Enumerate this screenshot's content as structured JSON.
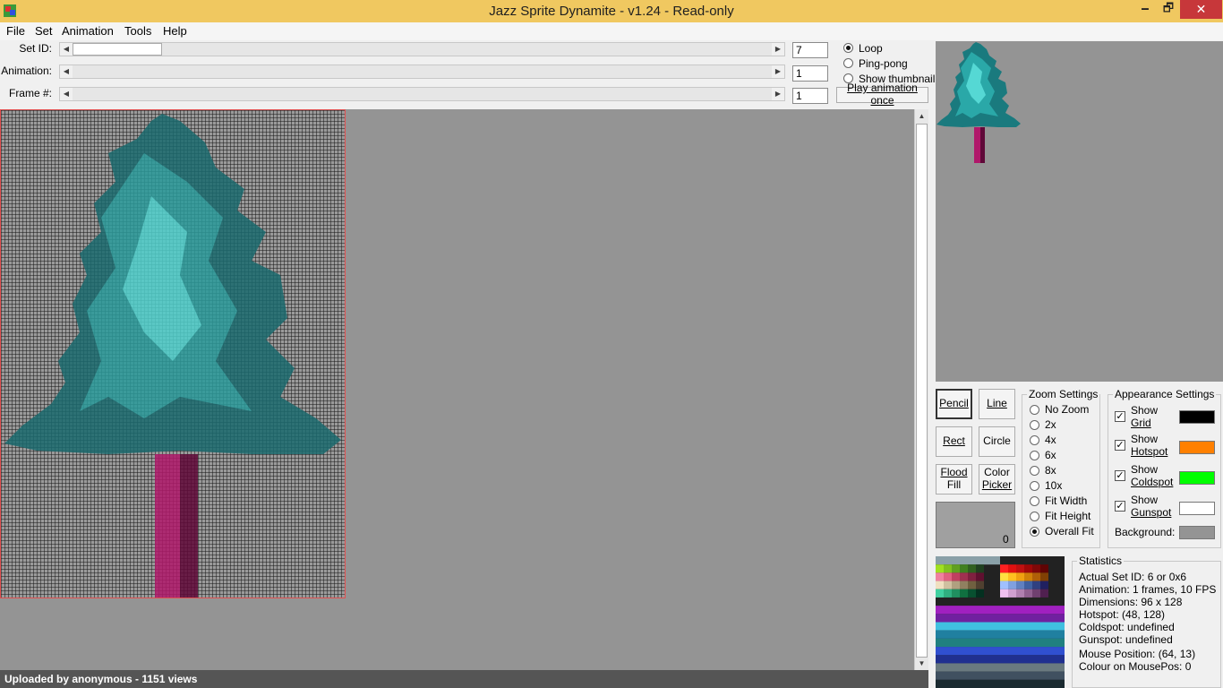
{
  "window": {
    "title": "Jazz Sprite Dynamite - v1.24 - Read-only",
    "min": "🗕",
    "max": "🗗",
    "close": "✕"
  },
  "menu": [
    "File",
    "Set",
    "Animation",
    "Tools",
    "Help"
  ],
  "controls": {
    "set_id": {
      "label": "Set ID:",
      "value": "7"
    },
    "animation": {
      "label": "Animation:",
      "value": "1"
    },
    "frame": {
      "label": "Frame #:",
      "value": "1"
    }
  },
  "playback": {
    "options": [
      "Loop",
      "Ping-pong",
      "Show thumbnail"
    ],
    "selected": "Loop",
    "play_button": "Play animation once"
  },
  "tools": {
    "pencil": "Pencil",
    "line": "Line",
    "rect": "Rect",
    "circle": "Circle",
    "flood_fill": [
      "Flood",
      "Fill"
    ],
    "color_picker": [
      "Color",
      "Picker"
    ],
    "selected": "Pencil",
    "color_index": "0"
  },
  "zoom": {
    "title": "Zoom Settings",
    "options": [
      "No Zoom",
      "2x",
      "4x",
      "6x",
      "8x",
      "10x",
      "Fit Width",
      "Fit Height",
      "Overall Fit"
    ],
    "selected": "Overall Fit"
  },
  "appearance": {
    "title": "Appearance Settings",
    "items": [
      {
        "line1": "Show",
        "line2": "Grid",
        "checked": true,
        "color": "#000000"
      },
      {
        "line1": "Show",
        "line2": "Hotspot",
        "checked": true,
        "color": "#ff8000"
      },
      {
        "line1": "Show",
        "line2": "Coldspot",
        "checked": true,
        "color": "#00ff00"
      },
      {
        "line1": "Show",
        "line2": "Gunspot",
        "checked": true,
        "color": "#ffffff"
      }
    ],
    "background_label": "Background:",
    "background_color": "#949494"
  },
  "statistics": {
    "title": "Statistics",
    "lines": [
      "Actual Set ID: 6 or 0x6",
      "Animation: 1 frames, 10 FPS",
      "Dimensions: 96 x 128",
      "Hotspot: (48, 128)",
      "Coldspot: undefined",
      "Gunspot: undefined",
      "Mouse Position: (64, 13)",
      "Colour on MousePos: 0"
    ]
  },
  "footer": {
    "note": "Uploaded by anonymous - 1151 views"
  },
  "icons": {
    "app": "jazz-sprite-icon",
    "scroll_left": "◀",
    "scroll_right": "▶",
    "scroll_up": "▲",
    "scroll_down": "▼",
    "check": "✓"
  }
}
